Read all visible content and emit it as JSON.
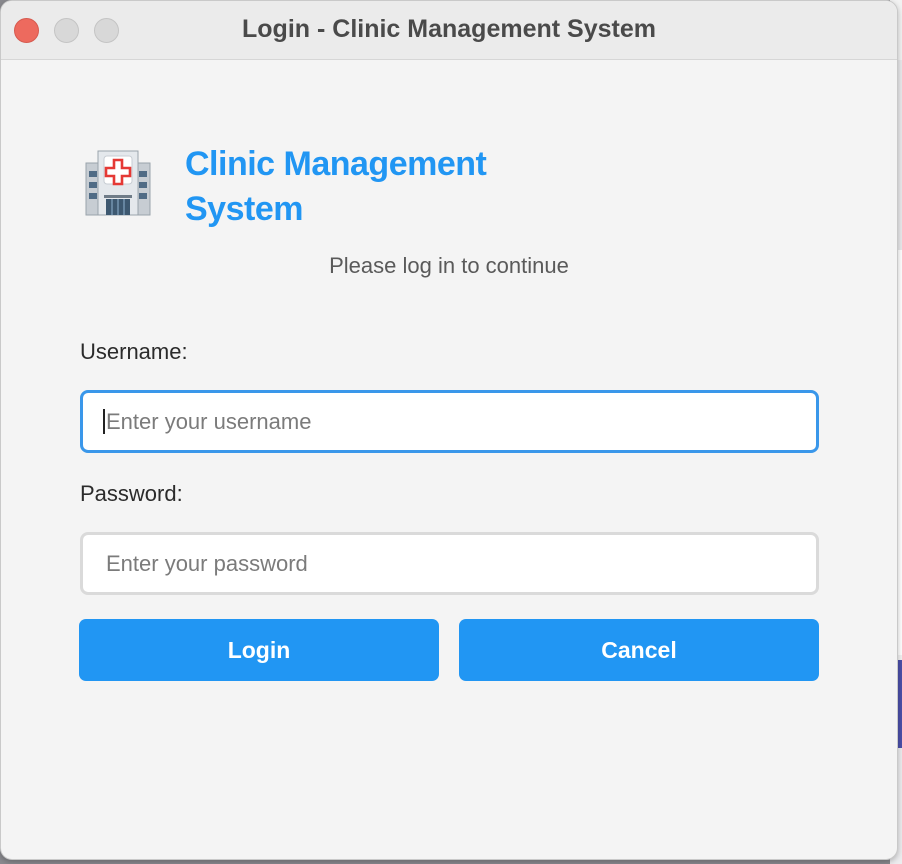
{
  "window": {
    "title": "Login - Clinic Management System"
  },
  "header": {
    "icon": "hospital-icon",
    "app_title": "Clinic Management System",
    "subtitle": "Please log in to continue"
  },
  "form": {
    "username_label": "Username:",
    "username_placeholder": "Enter your username",
    "username_value": "",
    "password_label": "Password:",
    "password_placeholder": "Enter your password",
    "password_value": ""
  },
  "buttons": {
    "login_label": "Login",
    "cancel_label": "Cancel"
  },
  "colors": {
    "accent": "#2196f3",
    "focus_border": "#3a97ea",
    "close_button": "#ed6a5e",
    "icon_cross": "#e53935"
  }
}
